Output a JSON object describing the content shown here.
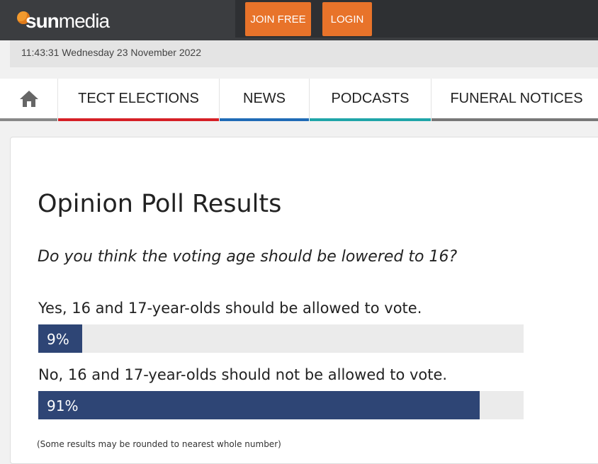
{
  "header": {
    "logo_sun": "sun",
    "logo_media": "media",
    "join_label": "JOIN FREE",
    "login_label": "LOGIN",
    "accent": "#e8732a"
  },
  "datebar": {
    "datetime": "11:43:31 Wednesday 23 November 2022"
  },
  "nav": {
    "home_icon": "home-icon",
    "items": [
      {
        "label": "TECT ELECTIONS",
        "color": "#d62026"
      },
      {
        "label": "NEWS",
        "color": "#1f6bb6"
      },
      {
        "label": "PODCASTS",
        "color": "#1fa5a8"
      },
      {
        "label": "FUNERAL NOTICES",
        "color": "#777777"
      }
    ]
  },
  "poll": {
    "title": "Opinion Poll Results",
    "question": "Do you think the voting age should be lowered to 16?",
    "options": [
      {
        "label": "Yes, 16 and 17-year-olds should be allowed to vote.",
        "percent": 9,
        "percent_label": "9%"
      },
      {
        "label": "No, 16 and 17-year-olds should not be allowed to vote.",
        "percent": 91,
        "percent_label": "91%"
      }
    ],
    "footnote": "(Some results may be rounded to nearest whole number)",
    "bar_color": "#2e4575"
  }
}
